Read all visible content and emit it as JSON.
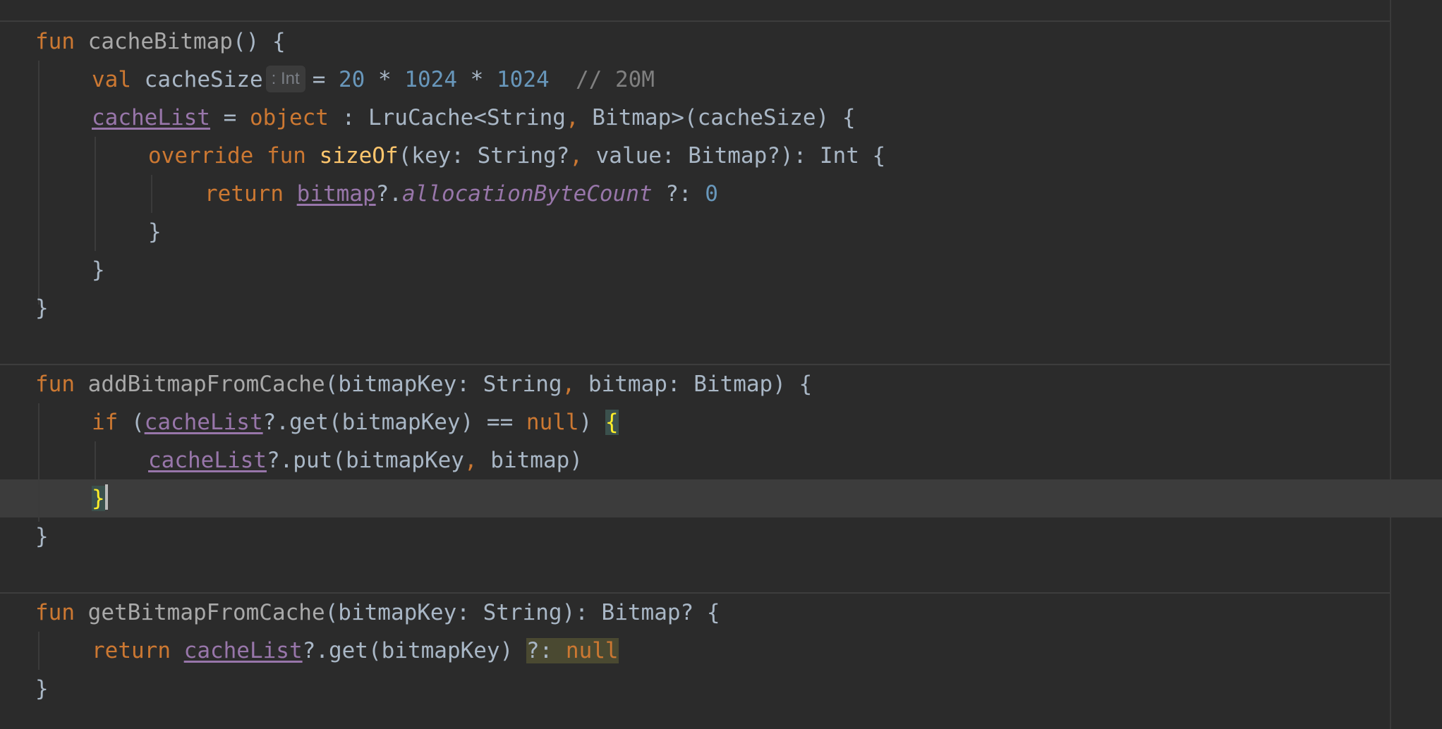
{
  "editor": {
    "lines": {
      "l1": {
        "kw_fun": "fun",
        "name": "cacheBitmap",
        "rest": "() {"
      },
      "l2": {
        "kw_val": "val",
        "name": "cacheSize",
        "type_hint": ": Int",
        "eq": "= ",
        "n1": "20",
        "op1": " * ",
        "n2": "1024",
        "op2": " * ",
        "n3": "1024",
        "comment": "  // 20M"
      },
      "l3": {
        "prop": "cacheList",
        "eq": " = ",
        "kw_object": "object",
        "colon": " : ",
        "type_a": "LruCache<String",
        "comma": ",",
        "type_b": " Bitmap>(cacheSize) {"
      },
      "l4": {
        "kw_override": "override",
        "kw_fun": "fun",
        "fn": "sizeOf",
        "params_a": "(key: String?",
        "comma": ",",
        "params_b": " value: Bitmap?): Int {"
      },
      "l5": {
        "kw_return": "return",
        "prop": "bitmap",
        "safe": "?.",
        "field": "allocationByteCount",
        "elvis": " ?: ",
        "zero": "0"
      },
      "l6": {
        "text": "}"
      },
      "l7": {
        "text": "}"
      },
      "l8": {
        "text": "}"
      },
      "l9": {
        "kw_fun": "fun",
        "name": "addBitmapFromCache",
        "params_a": "(bitmapKey: String",
        "comma": ",",
        "params_b": " bitmap: Bitmap) {"
      },
      "l10": {
        "kw_if": "if",
        "open": " (",
        "prop": "cacheList",
        "call": "?.get(bitmapKey) == ",
        "kw_null": "null",
        "close": ") ",
        "brace": "{"
      },
      "l11": {
        "prop": "cacheList",
        "call_a": "?.put(bitmapKey",
        "comma": ",",
        "call_b": " bitmap)"
      },
      "l12": {
        "brace": "}"
      },
      "l13": {
        "text": "}"
      },
      "l14": {
        "kw_fun": "fun",
        "name": "getBitmapFromCache",
        "rest": "(bitmapKey: String): Bitmap? {"
      },
      "l15": {
        "kw_return": "return",
        "prop": "cacheList",
        "call": "?.get(bitmapKey) ",
        "elvis": "?: ",
        "kw_null": "null"
      },
      "l16": {
        "text": "}"
      }
    }
  }
}
